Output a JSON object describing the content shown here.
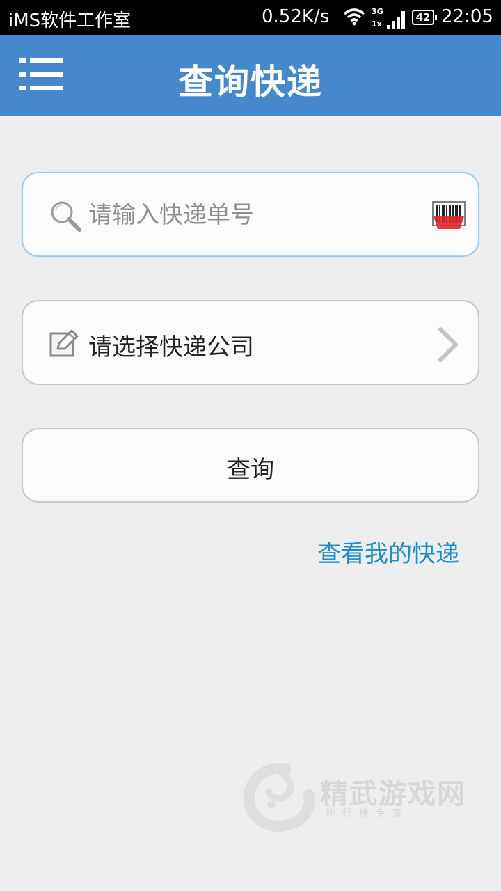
{
  "status_bar": {
    "carrier": "iMS软件工作室",
    "speed": "0.52K/s",
    "network": "3G",
    "network_sub": "1x",
    "battery": "42",
    "time": "22:05"
  },
  "header": {
    "title": "查询快递",
    "menu_icon": "hamburger-menu-icon",
    "color": "#4588cb"
  },
  "search": {
    "placeholder": "请输入快递单号",
    "value": "",
    "left_icon": "search-icon",
    "right_icon": "barcode-scan-icon"
  },
  "company_select": {
    "label": "请选择快递公司",
    "left_icon": "edit-icon",
    "right_icon": "chevron-right-icon"
  },
  "query_button": {
    "label": "查询"
  },
  "my_express_link": {
    "label": "查看我的快递",
    "color": "#1e8fc4"
  },
  "watermark": {
    "title": "精武游戏网",
    "subtitle": "排行榜专家"
  }
}
